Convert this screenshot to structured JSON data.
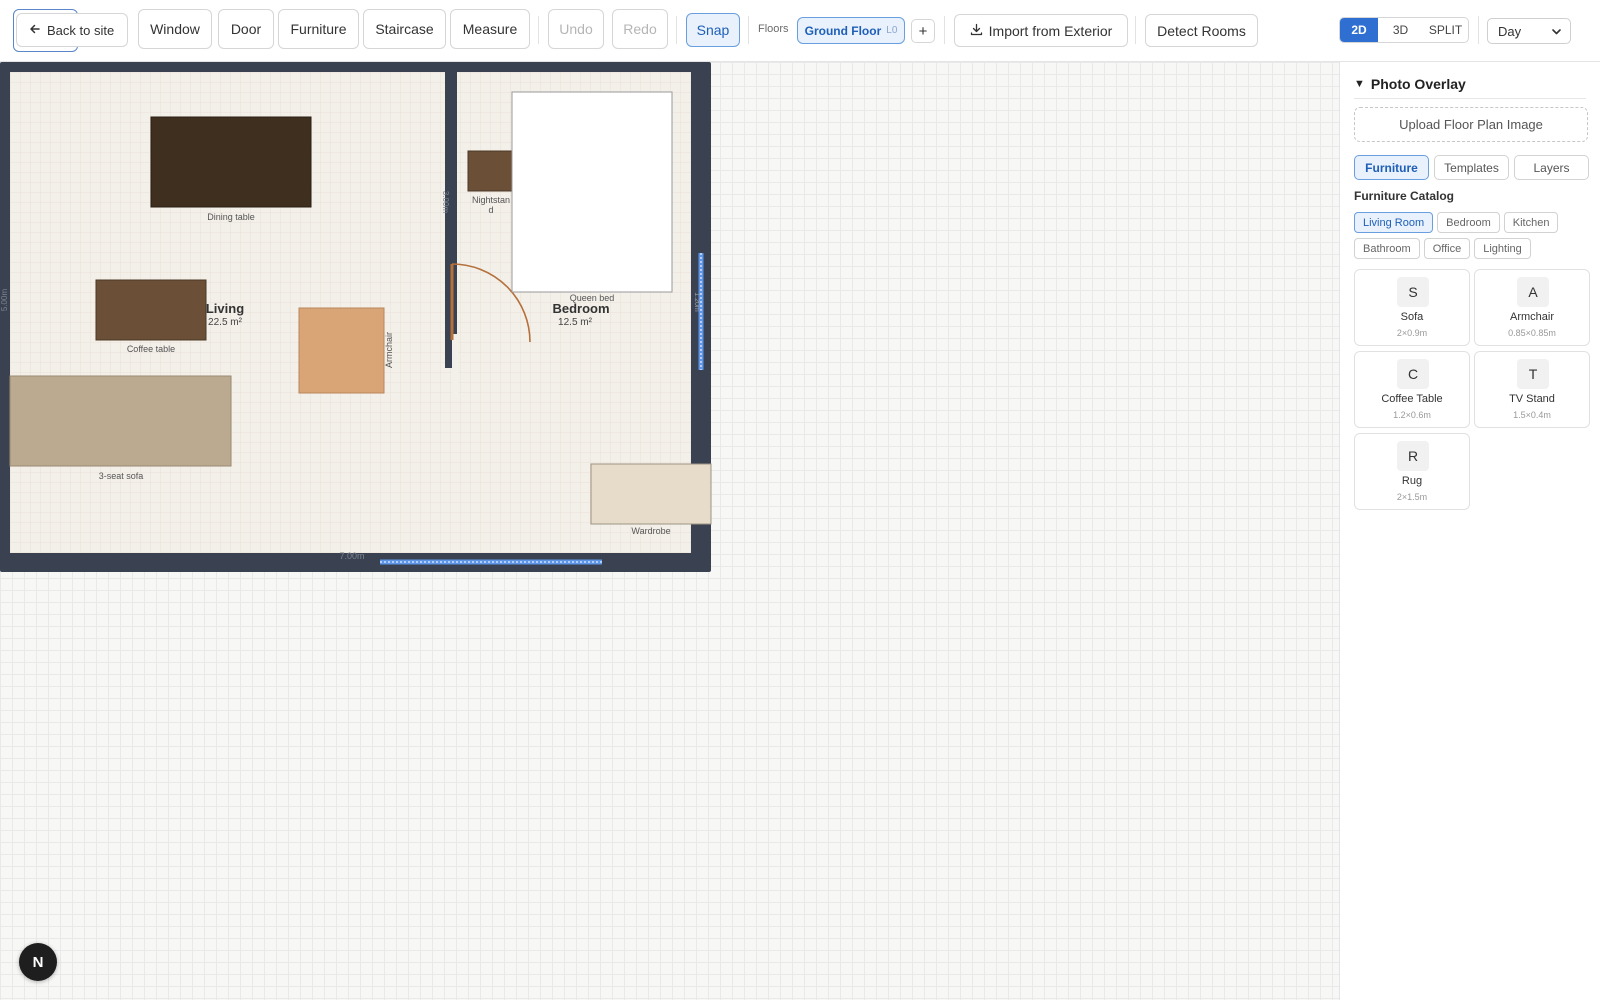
{
  "toolbar": {
    "back_label": "Back to site",
    "tools": [
      "Window",
      "Door",
      "Furniture",
      "Staircase",
      "Measure"
    ],
    "undo_label": "Undo",
    "redo_label": "Redo",
    "snap_label": "Snap",
    "floors_label": "Floors",
    "floor_name": "Ground Floor",
    "floor_level": "L0",
    "add_floor_label": "+",
    "import_label": "Import from Exterior",
    "detect_label": "Detect Rooms",
    "view_modes": [
      "2D",
      "3D",
      "SPLIT"
    ],
    "view_mode_selected": "2D",
    "lighting_select": "Day"
  },
  "plan": {
    "rooms": [
      {
        "name": "Living",
        "area": "22.5 m²"
      },
      {
        "name": "Bedroom",
        "area": "12.5 m²"
      }
    ],
    "furniture": {
      "dining_table": "Dining table",
      "coffee_table": "Coffee table",
      "sofa": "3-seat sofa",
      "armchair": "Armchair",
      "nightstand_line1": "Nightstan",
      "nightstand_line2": "d",
      "queen_bed": "Queen bed",
      "wardrobe": "Wardrobe"
    },
    "dimensions": {
      "bottom": "7.00m",
      "left": "5.00m",
      "partition": "3.00m",
      "right": "1.20m"
    }
  },
  "sidebar": {
    "panel_title": "Photo Overlay",
    "collapse_glyph": "▼",
    "upload_label": "Upload Floor Plan Image",
    "tabs": [
      "Furniture",
      "Templates",
      "Layers"
    ],
    "tab_selected": "Furniture",
    "catalog_title": "Furniture Catalog",
    "categories": [
      "Living Room",
      "Bedroom",
      "Kitchen",
      "Bathroom",
      "Office",
      "Lighting"
    ],
    "category_selected": "Living Room",
    "items": [
      {
        "letter": "S",
        "name": "Sofa",
        "dims": "2×0.9m"
      },
      {
        "letter": "A",
        "name": "Armchair",
        "dims": "0.85×0.85m"
      },
      {
        "letter": "C",
        "name": "Coffee Table",
        "dims": "1.2×0.6m"
      },
      {
        "letter": "T",
        "name": "TV Stand",
        "dims": "1.5×0.4m"
      },
      {
        "letter": "R",
        "name": "Rug",
        "dims": "2×1.5m"
      }
    ]
  },
  "badge": {
    "letter": "N"
  },
  "colors": {
    "accent": "#2f6fd1",
    "wall": "#3a4150",
    "floor": "#f3efe9",
    "dark_wood": "#3f2f1f",
    "mid_wood": "#6b5037",
    "tan": "#d9a577",
    "sofa": "#bba990",
    "wardrobe": "#e6dcc9",
    "door": "#b5703b",
    "window": "#5d96e6"
  }
}
